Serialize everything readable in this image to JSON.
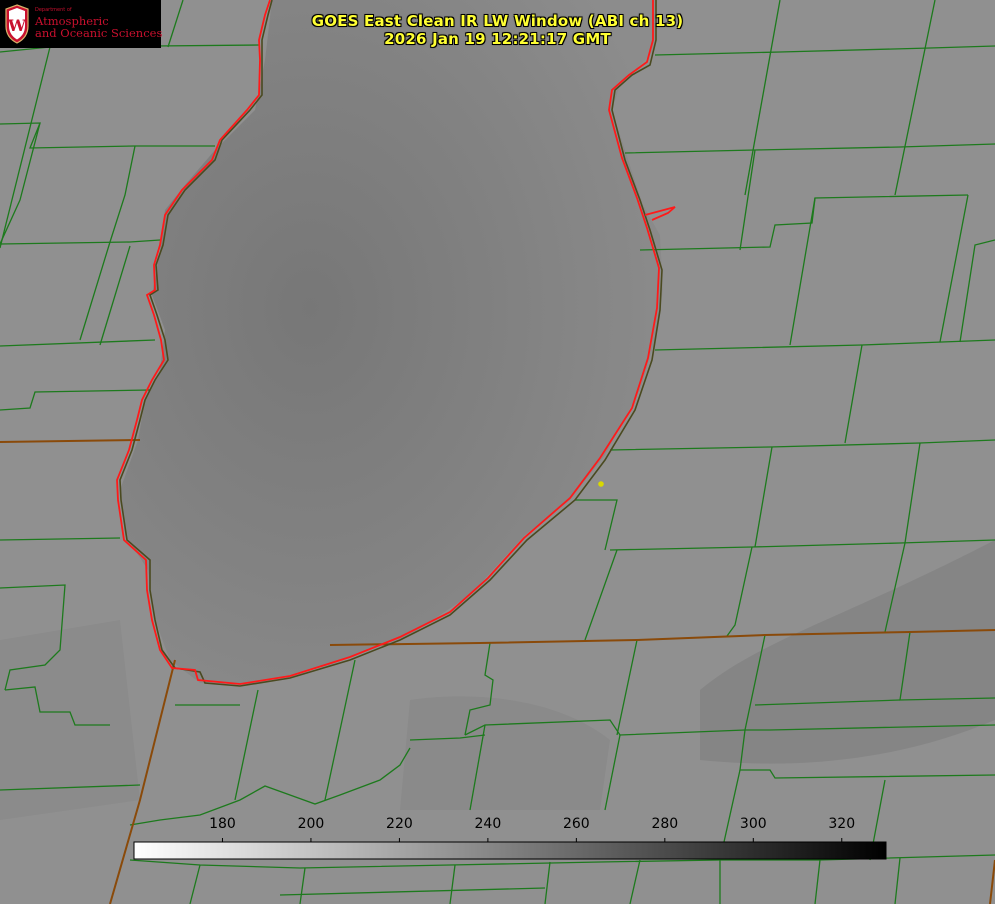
{
  "title": {
    "line1": "GOES East Clean IR LW Window (ABI ch 13)",
    "line2": "2026 Jan 19 12:21:17 GMT"
  },
  "logo": {
    "crest_letter": "W",
    "department": "Department of",
    "line1": "Atmospheric",
    "line2": "and Oceanic Sciences",
    "color": "#c8102e"
  },
  "colorbar": {
    "min": 160,
    "max": 330,
    "ticks": [
      {
        "label": "180",
        "value": 180
      },
      {
        "label": "200",
        "value": 200
      },
      {
        "label": "220",
        "value": 220
      },
      {
        "label": "240",
        "value": 240
      },
      {
        "label": "260",
        "value": 260
      },
      {
        "label": "280",
        "value": 280
      },
      {
        "label": "300",
        "value": 300
      },
      {
        "label": "320",
        "value": 320
      }
    ],
    "start_color": "#ffffff",
    "end_color": "#000000"
  },
  "colors": {
    "background": "#8f8f8f",
    "county_lines": "#1d7a1d",
    "state_lines": "#8a4a0a",
    "lake_outline": "#ff1a1a",
    "title_text": "#ffff33",
    "marker": "#d8d800"
  },
  "map": {
    "lake_feature": "lake",
    "marker": "location-marker"
  }
}
